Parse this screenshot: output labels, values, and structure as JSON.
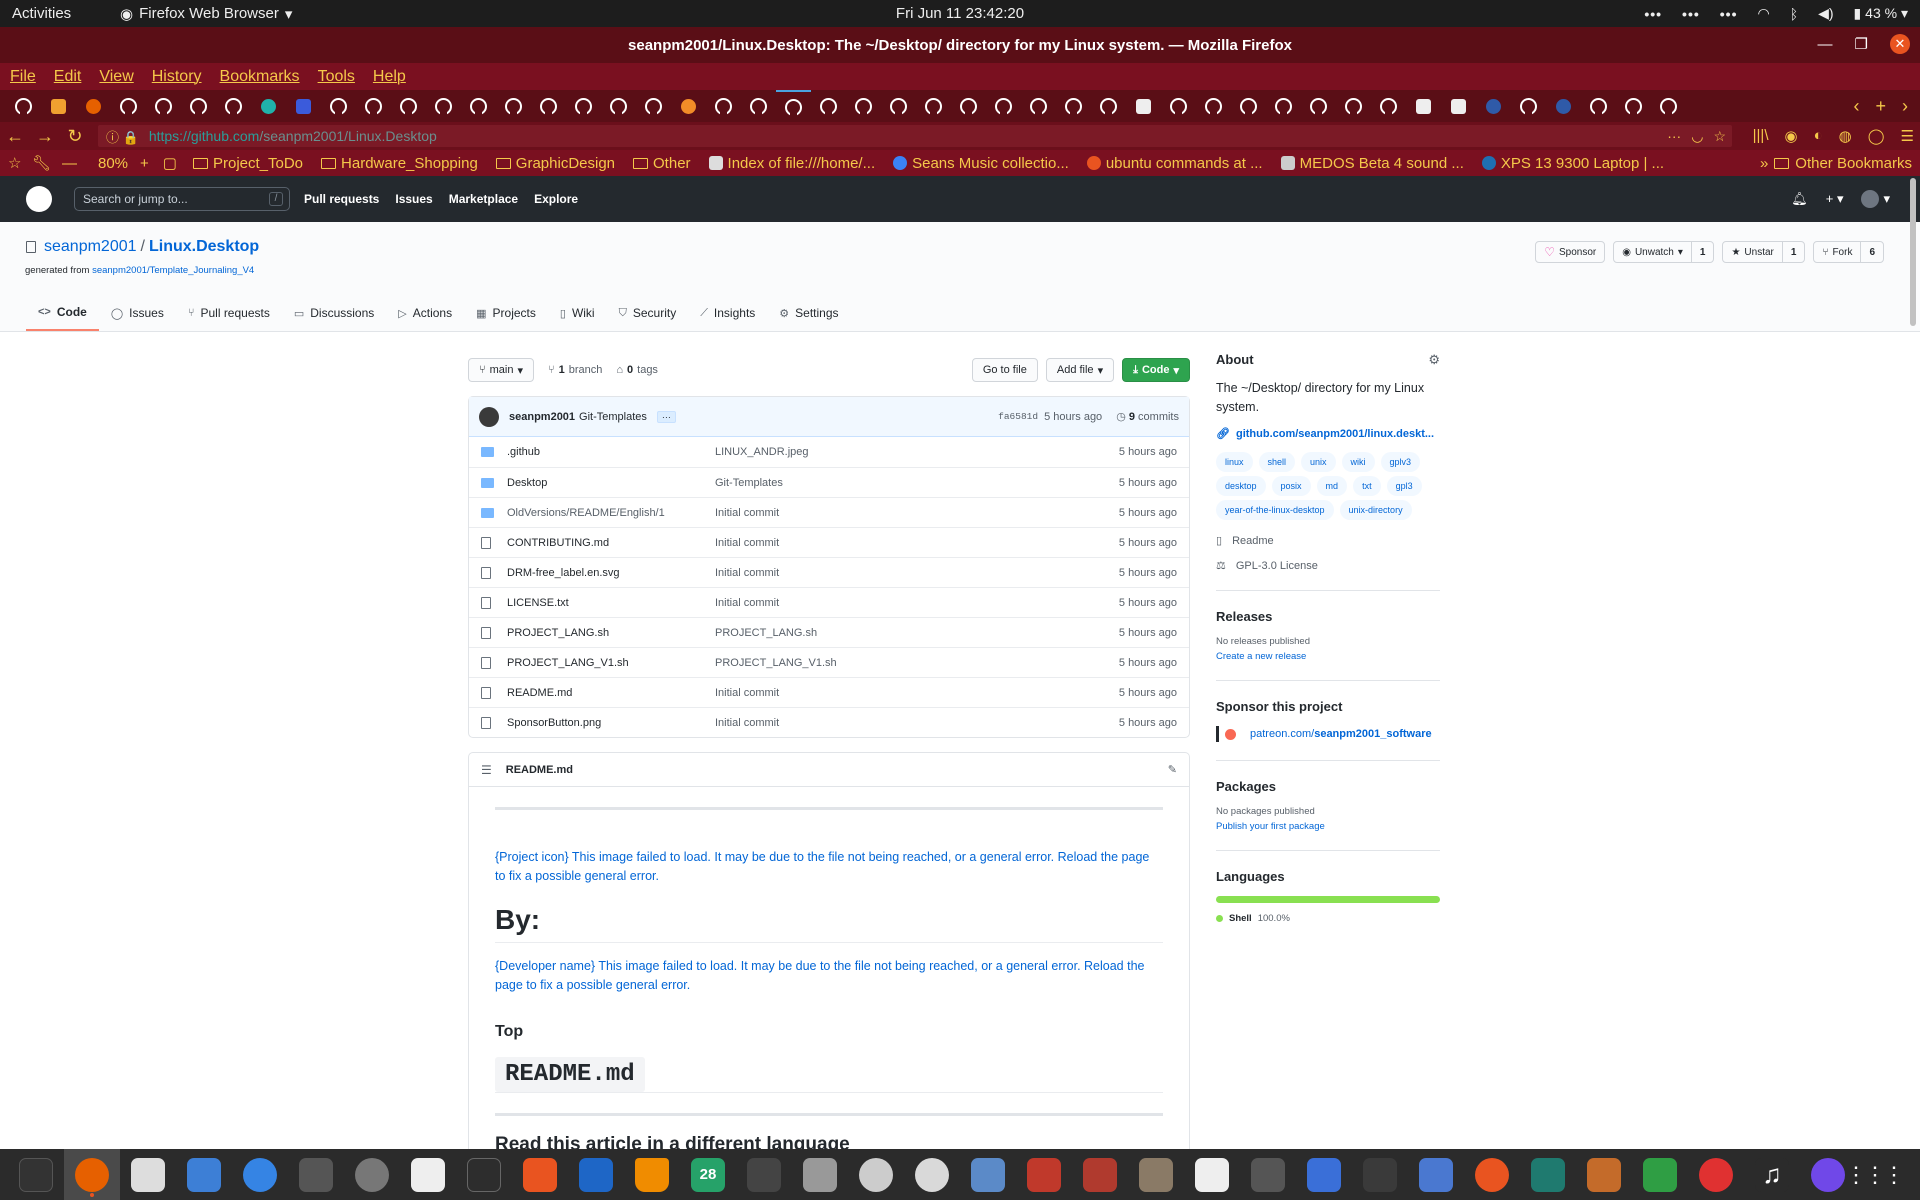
{
  "system": {
    "activities": "Activities",
    "app_name": "Firefox Web Browser",
    "clock": "Fri Jun 11  23:42:20",
    "battery": "43 %"
  },
  "window": {
    "title": "seanpm2001/Linux.Desktop: The ~/Desktop/ directory for my Linux system. — Mozilla Firefox"
  },
  "menu": [
    "File",
    "Edit",
    "View",
    "History",
    "Bookmarks",
    "Tools",
    "Help"
  ],
  "browser": {
    "url_host": "https://github.com",
    "url_path": "/seanpm2001/Linux.Desktop",
    "zoom": "80%"
  },
  "bookmarks": [
    {
      "label": "Project_ToDo",
      "kind": "folder"
    },
    {
      "label": "Hardware_Shopping",
      "kind": "folder"
    },
    {
      "label": "GraphicDesign",
      "kind": "folder"
    },
    {
      "label": "Other",
      "kind": "folder"
    },
    {
      "label": "Index of file:///home/...",
      "kind": "page"
    },
    {
      "label": "Seans Music collectio...",
      "kind": "page"
    },
    {
      "label": "ubuntu commands at ...",
      "kind": "page"
    },
    {
      "label": "MEDOS Beta 4 sound ...",
      "kind": "page"
    },
    {
      "label": "XPS 13 9300 Laptop | ...",
      "kind": "page"
    }
  ],
  "other_bookmarks": "Other Bookmarks",
  "gh": {
    "search_placeholder": "Search or jump to...",
    "search_key": "/",
    "nav": [
      "Pull requests",
      "Issues",
      "Marketplace",
      "Explore"
    ]
  },
  "repo": {
    "owner": "seanpm2001",
    "name": "Linux.Desktop",
    "generated_prefix": "generated from",
    "generated_link": "seanpm2001/Template_Journaling_V4",
    "sponsor": "Sponsor",
    "unwatch": "Unwatch",
    "watch_count": "1",
    "unstar": "Unstar",
    "star_count": "1",
    "fork": "Fork",
    "fork_count": "6",
    "tabs": [
      {
        "label": "Code",
        "icon": "<>"
      },
      {
        "label": "Issues",
        "icon": "◯"
      },
      {
        "label": "Pull requests",
        "icon": "⑂"
      },
      {
        "label": "Discussions",
        "icon": "▭"
      },
      {
        "label": "Actions",
        "icon": "▷"
      },
      {
        "label": "Projects",
        "icon": "▦"
      },
      {
        "label": "Wiki",
        "icon": "▯"
      },
      {
        "label": "Security",
        "icon": "⛉"
      },
      {
        "label": "Insights",
        "icon": "⟋"
      },
      {
        "label": "Settings",
        "icon": "⚙"
      }
    ]
  },
  "filenav": {
    "branch": "main",
    "branch_count": "1",
    "branch_label": "branch",
    "tag_count": "0",
    "tag_label": "tags",
    "go_to_file": "Go to file",
    "add_file": "Add file",
    "code": "Code"
  },
  "commit": {
    "author": "seanpm2001",
    "message": "Git-Templates",
    "ellipsis": "···",
    "sha": "fa6581d",
    "age": "5 hours ago",
    "count": "9",
    "count_label": "commits"
  },
  "files": [
    {
      "name": ".github",
      "type": "dir",
      "message": "LINUX_ANDR.jpeg",
      "age": "5 hours ago"
    },
    {
      "name": "Desktop",
      "type": "dir",
      "message": "Git-Templates",
      "age": "5 hours ago"
    },
    {
      "name": "OldVersions/README/English/1",
      "type": "dir",
      "message": "Initial commit",
      "age": "5 hours ago"
    },
    {
      "name": "CONTRIBUTING.md",
      "type": "file",
      "message": "Initial commit",
      "age": "5 hours ago"
    },
    {
      "name": "DRM-free_label.en.svg",
      "type": "file",
      "message": "Initial commit",
      "age": "5 hours ago"
    },
    {
      "name": "LICENSE.txt",
      "type": "file",
      "message": "Initial commit",
      "age": "5 hours ago"
    },
    {
      "name": "PROJECT_LANG.sh",
      "type": "file",
      "message": "PROJECT_LANG.sh",
      "age": "5 hours ago"
    },
    {
      "name": "PROJECT_LANG_V1.sh",
      "type": "file",
      "message": "PROJECT_LANG_V1.sh",
      "age": "5 hours ago"
    },
    {
      "name": "README.md",
      "type": "file",
      "message": "Initial commit",
      "age": "5 hours ago"
    },
    {
      "name": "SponsorButton.png",
      "type": "file",
      "message": "Initial commit",
      "age": "5 hours ago"
    }
  ],
  "readme": {
    "filename": "README.md",
    "img1": "{Project icon} This image failed to load. It may be due to the file not being reached, or a general error. Reload the page to fix a possible general error.",
    "by": "By:",
    "img2": "{Developer name} This image failed to load. It may be due to the file not being reached, or a general error. Reload the page to fix a possible general error.",
    "top": "Top",
    "code_heading": "README.md",
    "next_heading": "Read this article in a different language"
  },
  "about": {
    "title": "About",
    "description": "The ~/Desktop/ directory for my Linux system.",
    "homepage": "github.com/seanpm2001/linux.deskt...",
    "topics": [
      "linux",
      "shell",
      "unix",
      "wiki",
      "gplv3",
      "desktop",
      "posix",
      "md",
      "txt",
      "gpl3",
      "year-of-the-linux-desktop",
      "unix-directory"
    ],
    "readme": "Readme",
    "license": "GPL-3.0 License"
  },
  "releases": {
    "title": "Releases",
    "none": "No releases published",
    "create": "Create a new release"
  },
  "sponsor": {
    "title": "Sponsor this project",
    "link_prefix": "patreon.com/",
    "link_name": "seanpm2001_software"
  },
  "packages": {
    "title": "Packages",
    "none": "No packages published",
    "publish": "Publish your first package"
  },
  "languages": {
    "title": "Languages",
    "items": [
      {
        "name": "Shell",
        "pct": "100.0%",
        "color": "#89e051"
      }
    ]
  },
  "colors": {
    "accent": "#0366d6",
    "code_button": "#2ea44f",
    "firefox_theme": "#7a1020",
    "tab_underline": "#f9826c"
  },
  "dock": {
    "calendar_day": "28"
  }
}
